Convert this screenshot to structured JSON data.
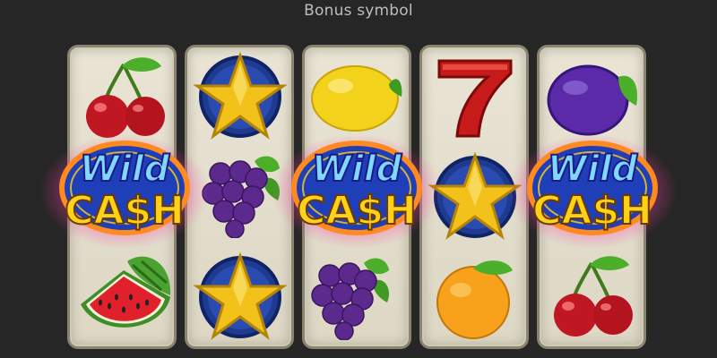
{
  "caption": "Bonus symbol",
  "reels": [
    [
      "cherry",
      "wild-cash",
      "watermelon"
    ],
    [
      "star",
      "grapes",
      "star"
    ],
    [
      "lemon",
      "wild-cash",
      "grapes"
    ],
    [
      "seven",
      "star",
      "orange"
    ],
    [
      "plum",
      "wild-cash",
      "cherry"
    ]
  ],
  "wild_symbol": {
    "line1": "Wild",
    "line2": "CA$H"
  },
  "colors": {
    "background": "#262626",
    "reel": "#e6e1d0",
    "wild_glow": "#ff3ea8",
    "wild_ring": "#ff8a1f",
    "wild_blue": "#1e3fb8",
    "cash_gold": "#ffd21a",
    "dollar_green": "#3fd12a"
  }
}
